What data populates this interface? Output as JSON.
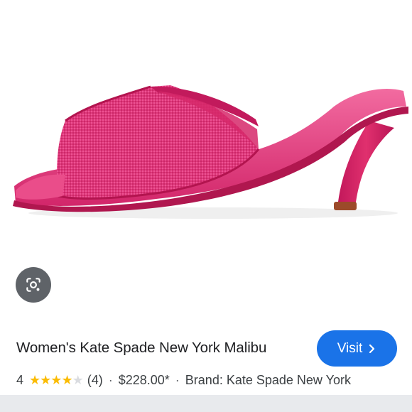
{
  "product": {
    "title": "Women's Kate Spade New York Malibu",
    "rating": "4",
    "rating_value": 4,
    "rating_max": 5,
    "review_count": "(4)",
    "price": "$228.00*",
    "brand": "Brand: Kate Spade New York"
  },
  "actions": {
    "visit_label": "Visit"
  },
  "icons": {
    "lens": "google-lens-icon",
    "chevron": "chevron-right-icon",
    "star": "star-icon"
  },
  "colors": {
    "accent": "#1a73e8",
    "star": "#fbbc04",
    "shoe": "#e0306e",
    "lens_bg": "#5f6368"
  },
  "separator": "·"
}
